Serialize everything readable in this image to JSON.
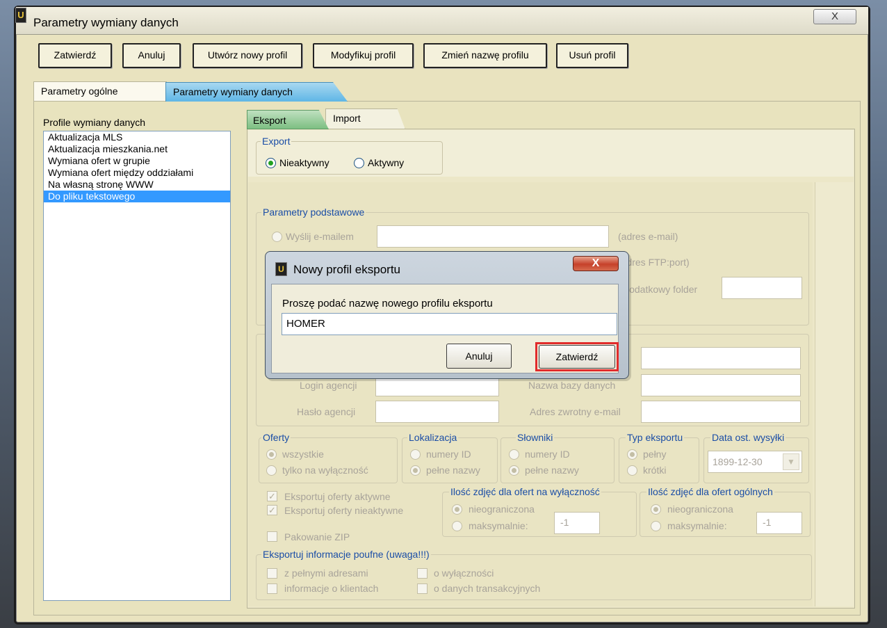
{
  "window": {
    "title": "Parametry wymiany danych",
    "close_glyph": "X",
    "icon_glyph": "U"
  },
  "toolbar": {
    "confirm": "Zatwierdź",
    "cancel": "Anuluj",
    "new_profile": "Utwórz nowy profil",
    "modify_profile": "Modyfikuj profil",
    "rename_profile": "Zmień nazwę profilu",
    "delete_profile": "Usuń profil"
  },
  "tabs": {
    "general": "Parametry ogólne",
    "exchange": "Parametry wymiany danych"
  },
  "profiles": {
    "title": "Profile wymiany danych",
    "items": [
      "Aktualizacja MLS",
      "Aktualizacja mieszkania.net",
      "Wymiana ofert w grupie",
      "Wymiana ofert między oddziałami",
      "Na własną stronę WWW",
      "Do pliku tekstowego"
    ],
    "selected_index": 5
  },
  "subtabs": {
    "export": "Eksport",
    "import": "Import"
  },
  "export_group": {
    "legend": "Export",
    "inactive": "Nieaktywny",
    "active": "Aktywny",
    "selected": "Nieaktywny"
  },
  "basic": {
    "legend": "Parametry podstawowe",
    "send_email": "Wyślij e-mailem",
    "email_hint": "(adres e-mail)",
    "ftp_hint": "(adres FTP:port)",
    "extra_folder": "Dodatkowy folder"
  },
  "agency": {
    "login": "Login agencji",
    "password": "Hasło agencji",
    "db_name": "Nazwa bazy danych",
    "return_email": "Adres zwrotny e-mail"
  },
  "offers": {
    "legend": "Oferty",
    "all": "wszystkie",
    "exclusive_only": "tylko na wyłączność"
  },
  "location": {
    "legend": "Lokalizacja",
    "ids": "numery ID",
    "full": "pełne nazwy"
  },
  "dictionaries": {
    "legend": "Słowniki",
    "ids": "numery ID",
    "full": "pełne nazwy"
  },
  "export_type": {
    "legend": "Typ eksportu",
    "full": "pełny",
    "short": "krótki"
  },
  "last_send": {
    "legend": "Data ost. wysyłki",
    "value": "1899-12-30"
  },
  "checks": {
    "active": "Eksportuj oferty aktywne",
    "inactive": "Eksportuj oferty nieaktywne",
    "zip": "Pakowanie ZIP"
  },
  "photos_exclusive": {
    "legend": "Ilość zdjęć dla ofert na wyłączność",
    "unlimited": "nieograniczona",
    "max": "maksymalnie:",
    "value": "-1"
  },
  "photos_general": {
    "legend": "Ilość zdjęć dla ofert ogólnych",
    "unlimited": "nieograniczona",
    "max": "maksymalnie:",
    "value": "-1"
  },
  "confidential": {
    "legend": "Eksportuj informacje poufne (uwaga!!!)",
    "full_addresses": "z pełnymi adresami",
    "exclusivity": "o wyłączności",
    "client_info": "informacje o klientach",
    "transaction": "o danych transakcyjnych"
  },
  "dialog": {
    "title": "Nowy profil eksportu",
    "icon_glyph": "U",
    "close_glyph": "X",
    "prompt": "Proszę podać nazwę nowego profilu eksportu",
    "value": "HOMER",
    "cancel": "Anuluj",
    "confirm": "Zatwierdź"
  }
}
